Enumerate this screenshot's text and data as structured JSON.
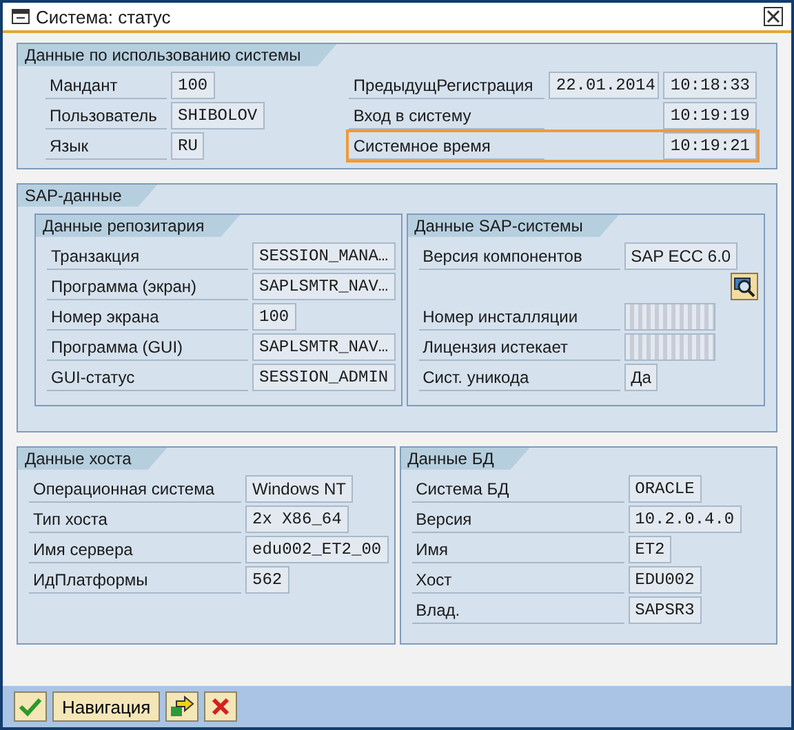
{
  "window": {
    "title": "Система: статус"
  },
  "usage": {
    "title": "Данные по использованию системы",
    "left": [
      {
        "label": "Мандант",
        "value": "100",
        "kind": "mono"
      },
      {
        "label": "Пользователь",
        "value": "SHIBOLOV",
        "kind": "mono"
      },
      {
        "label": "Язык",
        "value": "RU",
        "kind": "mono"
      }
    ],
    "right": [
      {
        "label": "ПредыдущРегистрация",
        "date": "22.01.2014",
        "time": "10:18:33",
        "highlighted": false
      },
      {
        "label": "Вход в систему",
        "time": "10:19:19",
        "highlighted": false
      },
      {
        "label": "Системное время",
        "time": "10:19:21",
        "highlighted": true
      }
    ]
  },
  "sap_data": {
    "title": "SAP-данные",
    "panels": [
      {
        "title": "Данные репозитария",
        "rows": [
          {
            "kind": "mono",
            "label": "Транзакция",
            "value": "SESSION_MANA…"
          },
          {
            "kind": "mono",
            "label": "Программа (экран)",
            "value": "SAPLSMTR_NAV…"
          },
          {
            "kind": "mono",
            "label": "Номер экрана",
            "value": "100"
          },
          {
            "kind": "mono",
            "label": "Программа (GUI)",
            "value": "SAPLSMTR_NAV…"
          },
          {
            "kind": "mono",
            "label": "GUI-статус",
            "value": "SESSION_ADMIN"
          }
        ]
      },
      {
        "title": "Данные SAP-системы",
        "rows": [
          {
            "kind": "text",
            "label": "Версия компонентов",
            "value": "SAP ECC 6.0"
          },
          {
            "kind": "lookup"
          },
          {
            "kind": "blurred",
            "label": "Номер инсталляции"
          },
          {
            "kind": "blurred",
            "label": "Лицензия истекает"
          },
          {
            "kind": "text",
            "label": "Сист. уникода",
            "value": "Да"
          }
        ]
      }
    ]
  },
  "bottom": [
    {
      "title": "Данные хоста",
      "rows": [
        {
          "kind": "text",
          "label": "Операционная система",
          "value": "Windows NT"
        },
        {
          "kind": "mono",
          "label": "Тип хоста",
          "value": "2x X86_64"
        },
        {
          "kind": "mono",
          "label": "Имя сервера",
          "value": "edu002_ET2_00"
        },
        {
          "kind": "mono",
          "label": "ИдПлатформы",
          "value": "562"
        }
      ]
    },
    {
      "title": "Данные БД",
      "rows": [
        {
          "kind": "mono",
          "label": "Система БД",
          "value": "ORACLE"
        },
        {
          "kind": "mono",
          "label": "Версия",
          "value": "10.2.0.4.0"
        },
        {
          "kind": "mono",
          "label": "Имя",
          "value": "ET2"
        },
        {
          "kind": "mono",
          "label": "Хост",
          "value": "EDU002"
        },
        {
          "kind": "mono",
          "label": "Влад.",
          "value": "SAPSR3"
        }
      ]
    }
  ],
  "footer": {
    "buttons": [
      {
        "kind": "confirm"
      },
      {
        "kind": "text",
        "label": "Навигация"
      },
      {
        "kind": "forward"
      },
      {
        "kind": "cancel"
      }
    ]
  }
}
